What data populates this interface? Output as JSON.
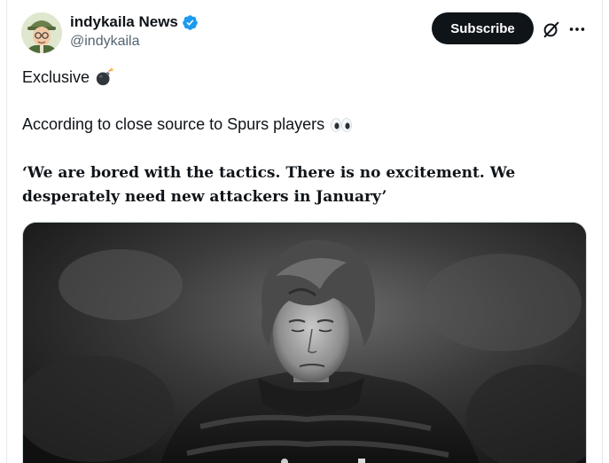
{
  "header": {
    "display_name": "indykaila News",
    "handle": "@indykaila",
    "subscribe_label": "Subscribe",
    "verified_color": "#1d9bf0"
  },
  "tweet": {
    "line1": "Exclusive",
    "line1_icon": "bomb-emoji",
    "line2": "According to close source to Spurs players",
    "line2_icon": "eyes-emoji",
    "quote": "‘We are bored with the tactics. There is no excitement. We desperately need new attackers in January’"
  },
  "media": {
    "type": "photo",
    "style": "black-and-white"
  },
  "icons": {
    "grok": "grok-icon",
    "more": "more-icon",
    "verified": "verified-badge-icon"
  }
}
